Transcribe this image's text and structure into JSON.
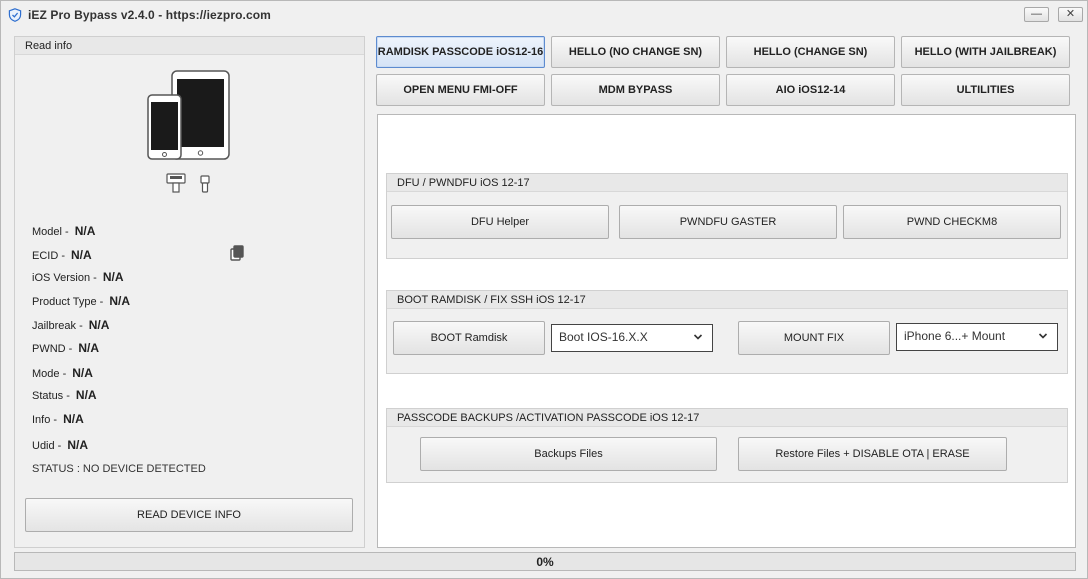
{
  "window": {
    "title": "iEZ Pro Bypass v2.4.0 - https://iezpro.com",
    "minimize_glyph": "—",
    "close_glyph": "✕"
  },
  "left_panel": {
    "header": "Read info",
    "device_info": [
      {
        "label": "Model -",
        "value": "N/A"
      },
      {
        "label": "ECID -",
        "value": "N/A"
      },
      {
        "label": "iOS Version -",
        "value": "N/A"
      },
      {
        "label": "Product Type -",
        "value": "N/A"
      },
      {
        "label": "Jailbreak -",
        "value": "N/A"
      },
      {
        "label": "PWND -",
        "value": "N/A"
      },
      {
        "label": "Mode -",
        "value": "N/A"
      },
      {
        "label": "Status -",
        "value": "N/A"
      },
      {
        "label": "Info -",
        "value": "N/A"
      },
      {
        "label": "Udid -",
        "value": "N/A"
      }
    ],
    "status_text": "STATUS : NO DEVICE DETECTED",
    "read_button": "READ DEVICE INFO"
  },
  "menu": {
    "row1": [
      "RAMDISK PASSCODE iOS12-16",
      "HELLO (NO CHANGE SN)",
      "HELLO (CHANGE SN)",
      "HELLO (WITH JAILBREAK)"
    ],
    "row2": [
      "OPEN MENU FMI-OFF",
      "MDM BYPASS",
      "AIO iOS12-14",
      "ULTILITIES"
    ],
    "active": "RAMDISK PASSCODE iOS12-16"
  },
  "dfu_group": {
    "header": "DFU / PWNDFU iOS 12-17",
    "buttons": [
      "DFU Helper",
      "PWNDFU GASTER",
      "PWND CHECKM8"
    ]
  },
  "boot_group": {
    "header": "BOOT RAMDISK / FIX SSH iOS 12-17",
    "boot_button": "BOOT Ramdisk",
    "boot_select": "Boot IOS-16.X.X",
    "mount_button": "MOUNT FIX",
    "mount_select": "iPhone  6...+ Mount"
  },
  "backup_group": {
    "header": "PASSCODE BACKUPS /ACTIVATION PASSCODE iOS 12-17",
    "backup_button": "Backups Files",
    "restore_button": "Restore Files   + DISABLE OTA | ERASE"
  },
  "progress": {
    "value": 0,
    "label": "0%"
  },
  "colors": {
    "active_border": "#5d8bcf",
    "progress_fill": "#6fc26f"
  }
}
